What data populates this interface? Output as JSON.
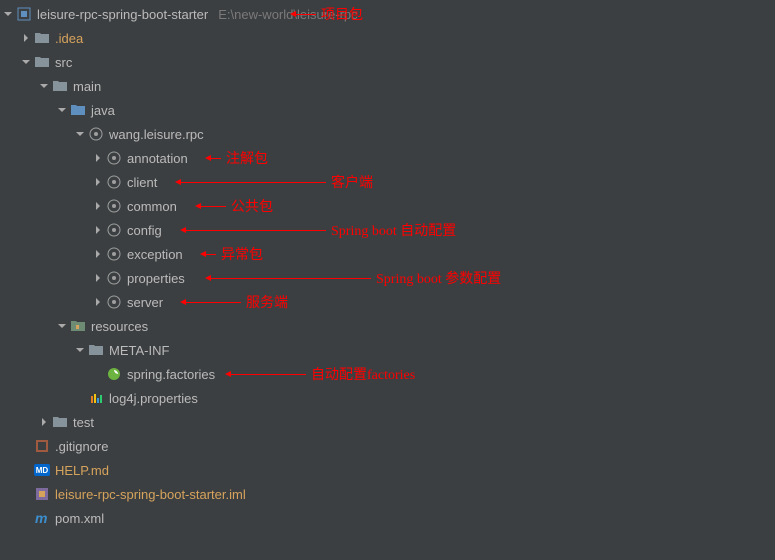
{
  "root": {
    "name": "leisure-rpc-spring-boot-starter",
    "path": "E:\\new-world\\leisure-rpc"
  },
  "items": {
    "idea": ".idea",
    "src": "src",
    "main": "main",
    "java": "java",
    "pkg": "wang.leisure.rpc",
    "annotation": "annotation",
    "client": "client",
    "common": "common",
    "config": "config",
    "exception": "exception",
    "properties": "properties",
    "server": "server",
    "resources": "resources",
    "metainf": "META-INF",
    "springfactories": "spring.factories",
    "log4j": "log4j.properties",
    "test": "test",
    "gitignore": ".gitignore",
    "helpmd": "HELP.md",
    "iml": "leisure-rpc-spring-boot-starter.iml",
    "pom": "pom.xml"
  },
  "annotations": {
    "root": "项目包",
    "annotation": "注解包",
    "client": "客户端",
    "common": "公共包",
    "config": "Spring boot 自动配置",
    "exception": "异常包",
    "properties": "Spring boot 参数配置",
    "server": "服务端",
    "springfactories": "自动配置factories"
  }
}
